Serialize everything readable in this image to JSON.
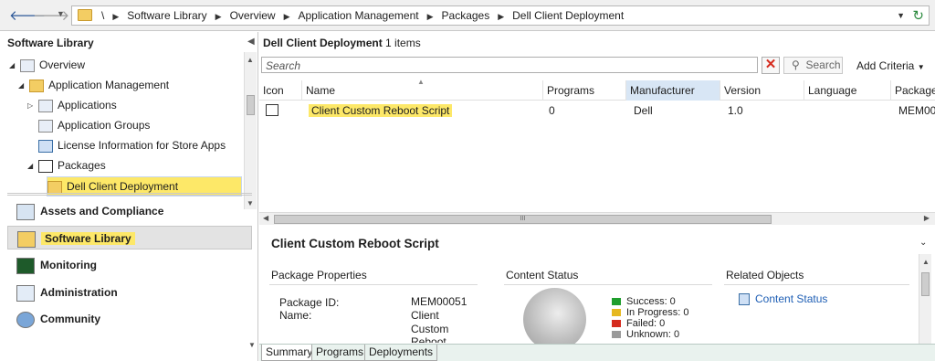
{
  "address": {
    "root": "\\",
    "crumbs": [
      "Software Library",
      "Overview",
      "Application Management",
      "Packages",
      "Dell Client Deployment"
    ]
  },
  "left": {
    "title": "Software Library",
    "tree": [
      {
        "label": "Overview",
        "arrow": "◢",
        "icon": "overview-icon"
      },
      {
        "label": "Application Management",
        "arrow": "◢",
        "icon": "folder-icon"
      },
      {
        "label": "Applications",
        "arrow": "▷",
        "icon": "applications-icon"
      },
      {
        "label": "Application Groups",
        "arrow": "",
        "icon": "application-groups-icon"
      },
      {
        "label": "License Information for Store Apps",
        "arrow": "",
        "icon": "license-icon"
      },
      {
        "label": "Packages",
        "arrow": "◢",
        "icon": "package-icon"
      },
      {
        "label": "Dell Client Deployment",
        "arrow": "",
        "icon": "folder-icon"
      }
    ],
    "workspaces": [
      {
        "label": "Assets and Compliance",
        "icon": "assets-compliance-icon"
      },
      {
        "label": "Software Library",
        "icon": "software-library-icon"
      },
      {
        "label": "Monitoring",
        "icon": "monitoring-icon"
      },
      {
        "label": "Administration",
        "icon": "administration-icon"
      },
      {
        "label": "Community",
        "icon": "community-icon"
      }
    ]
  },
  "list": {
    "title": "Dell Client Deployment",
    "count": "1 items",
    "search_placeholder": "Search",
    "search_button": "Search",
    "add_criteria": "Add Criteria",
    "columns": [
      "Icon",
      "Name",
      "Programs",
      "Manufacturer",
      "Version",
      "Language",
      "Package"
    ],
    "rows": [
      {
        "name": "Client Custom Reboot Script",
        "programs": "0",
        "manufacturer": "Dell",
        "version": "1.0",
        "language": "",
        "package": "MEM00"
      }
    ],
    "hscroll_glyph": "III"
  },
  "details": {
    "title": "Client Custom Reboot Script",
    "sections": [
      "Package Properties",
      "Content Status",
      "Related Objects"
    ],
    "properties": {
      "package_id_label": "Package ID:",
      "package_id": "MEM00051",
      "name_label": "Name:",
      "name_lines": [
        "Client",
        "Custom",
        "Reboot"
      ]
    },
    "content_status": [
      {
        "label": "Success: 0",
        "color": "#1f9e2d"
      },
      {
        "label": "In Progress: 0",
        "color": "#e6b820"
      },
      {
        "label": "Failed: 0",
        "color": "#d52b1e"
      },
      {
        "label": "Unknown: 0",
        "color": "#9a9a9a"
      }
    ],
    "related_link": "Content Status",
    "tabs": [
      "Summary",
      "Programs",
      "Deployments"
    ]
  },
  "colors": {
    "highlight": "#fde868",
    "link": "#1f5fb5"
  }
}
